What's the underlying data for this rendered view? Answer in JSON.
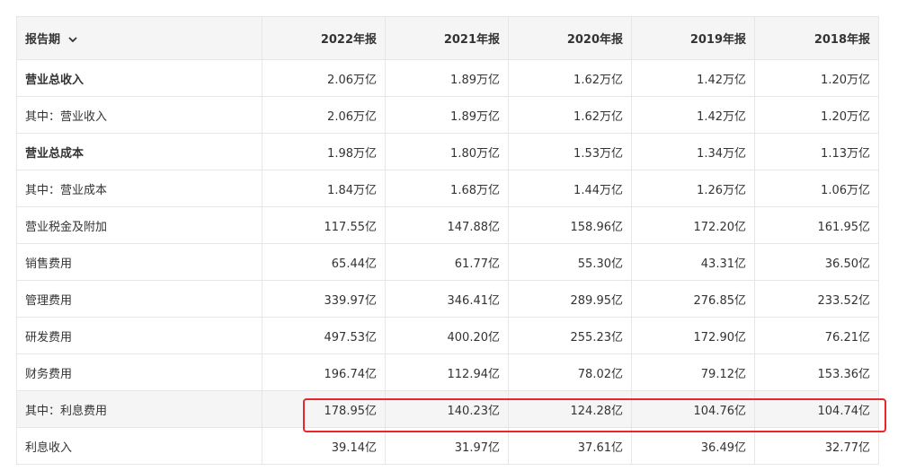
{
  "header": {
    "period_label": "报告期",
    "years": [
      "2022年报",
      "2021年报",
      "2020年报",
      "2019年报",
      "2018年报"
    ]
  },
  "rows": [
    {
      "label": "营业总收入",
      "bold": true,
      "values": [
        "2.06万亿",
        "1.89万亿",
        "1.62万亿",
        "1.42万亿",
        "1.20万亿"
      ]
    },
    {
      "label": "其中：营业收入",
      "bold": false,
      "values": [
        "2.06万亿",
        "1.89万亿",
        "1.62万亿",
        "1.42万亿",
        "1.20万亿"
      ]
    },
    {
      "label": "营业总成本",
      "bold": true,
      "values": [
        "1.98万亿",
        "1.80万亿",
        "1.53万亿",
        "1.34万亿",
        "1.13万亿"
      ]
    },
    {
      "label": "其中：营业成本",
      "bold": false,
      "values": [
        "1.84万亿",
        "1.68万亿",
        "1.44万亿",
        "1.26万亿",
        "1.06万亿"
      ]
    },
    {
      "label": "营业税金及附加",
      "bold": false,
      "values": [
        "117.55亿",
        "147.88亿",
        "158.96亿",
        "172.20亿",
        "161.95亿"
      ]
    },
    {
      "label": "销售费用",
      "bold": false,
      "values": [
        "65.44亿",
        "61.77亿",
        "55.30亿",
        "43.31亿",
        "36.50亿"
      ]
    },
    {
      "label": "管理费用",
      "bold": false,
      "values": [
        "339.97亿",
        "346.41亿",
        "289.95亿",
        "276.85亿",
        "233.52亿"
      ]
    },
    {
      "label": "研发费用",
      "bold": false,
      "values": [
        "497.53亿",
        "400.20亿",
        "255.23亿",
        "172.90亿",
        "76.21亿"
      ]
    },
    {
      "label": "财务费用",
      "bold": false,
      "values": [
        "196.74亿",
        "112.94亿",
        "78.02亿",
        "79.12亿",
        "153.36亿"
      ]
    },
    {
      "label": "其中：利息费用",
      "bold": false,
      "highlighted": true,
      "values": [
        "178.95亿",
        "140.23亿",
        "124.28亿",
        "104.76亿",
        "104.74亿"
      ]
    },
    {
      "label": "利息收入",
      "bold": false,
      "values": [
        "39.14亿",
        "31.97亿",
        "37.61亿",
        "36.49亿",
        "32.77亿"
      ]
    }
  ],
  "colors": {
    "header_bg": "#f5f5f5",
    "border": "#e6e6e6",
    "highlight_border": "#e8262b"
  },
  "icons": {
    "period_dropdown": "chevron-down-icon"
  }
}
